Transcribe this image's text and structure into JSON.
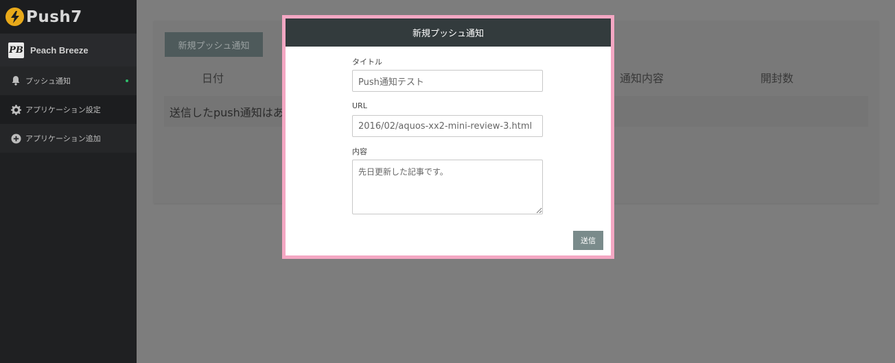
{
  "app": {
    "logo_text": "Push7",
    "current_app_name": "Peach Breeze",
    "current_app_avatar": "PB"
  },
  "sidebar": {
    "items": [
      {
        "label": "プッシュ通知",
        "icon": "bell-icon"
      },
      {
        "label": "アプリケーション設定",
        "icon": "gear-icon"
      },
      {
        "label": "アプリケーション追加",
        "icon": "plus-circle-icon"
      }
    ]
  },
  "main": {
    "new_push_button": "新規プッシュ通知",
    "table_headers": {
      "date": "日付",
      "content": "通知内容",
      "opens": "開封数"
    },
    "empty_message": "送信したpush通知はあ"
  },
  "modal": {
    "title": "新規プッシュ通知",
    "title_label": "タイトル",
    "title_value": "Push通知テスト",
    "url_label": "URL",
    "url_value": "2016/02/aquos-xx2-mini-review-3.html",
    "content_label": "内容",
    "content_value": "先日更新した記事です。",
    "send_button": "送信"
  },
  "colors": {
    "logo_accent": "#e8a91a",
    "modal_border": "#f4a7c3",
    "modal_header": "#333b3d",
    "status_dot": "#2ebd6b"
  }
}
